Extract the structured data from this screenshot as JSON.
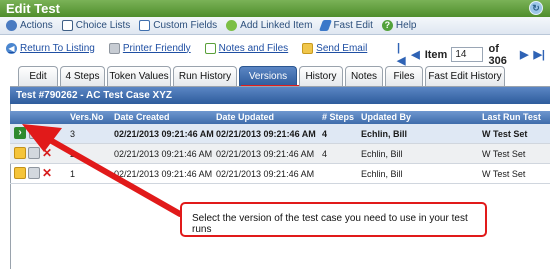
{
  "title": "Edit Test",
  "toolbar": [
    {
      "icon": "gear-icon",
      "label": "Actions"
    },
    {
      "icon": "list-icon",
      "label": "Choice Lists"
    },
    {
      "icon": "fields-icon",
      "label": "Custom Fields"
    },
    {
      "icon": "link-icon",
      "label": "Add Linked Item"
    },
    {
      "icon": "edit-icon",
      "label": "Fast Edit"
    },
    {
      "icon": "help-icon",
      "label": "Help"
    }
  ],
  "links": [
    {
      "icon": "back-icon",
      "label": "Return To Listing"
    },
    {
      "icon": "printer-icon",
      "label": "Printer Friendly"
    },
    {
      "icon": "notes-icon",
      "label": "Notes and Files"
    },
    {
      "icon": "mail-icon",
      "label": "Send Email"
    }
  ],
  "pager": {
    "item_label": "Item",
    "item_value": "14",
    "of_label": "of 306"
  },
  "tabs": [
    "Edit",
    "4 Steps",
    "Token Values",
    "Run History",
    "Versions",
    "History",
    "Notes",
    "Files",
    "Fast Edit History"
  ],
  "active_tab": "Versions",
  "panel_title": "Test #790262 - AC Test Case XYZ",
  "columns": [
    "Vers.No",
    "Date Created",
    "Date Updated",
    "# Steps",
    "Updated By",
    "Last Run Test"
  ],
  "rows": [
    {
      "vers": "3",
      "created": "02/21/2013 09:21:46 AM",
      "updated": "02/21/2013 09:21:46 AM",
      "steps": "4",
      "by": "Echlin, Bill",
      "last_run": "W Test Set"
    },
    {
      "vers": "2",
      "created": "02/21/2013 09:21:46 AM",
      "updated": "02/21/2013 09:21:46 AM",
      "steps": "4",
      "by": "Echlin, Bill",
      "last_run": "W Test Set"
    },
    {
      "vers": "1",
      "created": "02/21/2013 09:21:46 AM",
      "updated": "02/21/2013 09:21:46 AM",
      "steps": "",
      "by": "Echlin, Bill",
      "last_run": "W Test Set"
    }
  ],
  "callout": "Select the version of the test case you need to use in your test runs",
  "colors": {
    "title_green": "#5a9a36",
    "header_blue": "#3e6cab",
    "annotation_red": "#e11a1a"
  }
}
